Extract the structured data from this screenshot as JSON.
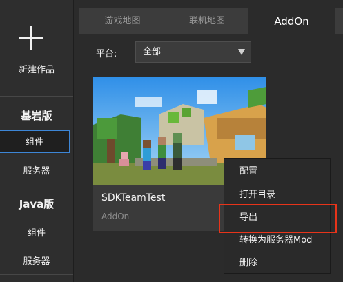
{
  "sidebar": {
    "new_work_label": "新建作品",
    "bedrock": {
      "title": "基岩版",
      "items": [
        "组件",
        "服务器"
      ]
    },
    "java": {
      "title": "Java版",
      "items": [
        "组件",
        "服务器"
      ]
    }
  },
  "tabs": [
    {
      "label": "游戏地图",
      "active": false
    },
    {
      "label": "联机地图",
      "active": false
    },
    {
      "label": "AddOn",
      "active": true
    }
  ],
  "filter": {
    "label": "平台:",
    "selected": "全部"
  },
  "card": {
    "title": "SDKTeamTest",
    "type": "AddOn",
    "thumbnail": "minecraft-scene-image"
  },
  "context_menu": {
    "items": [
      "配置",
      "打开目录",
      "导出",
      "转换为服务器Mod",
      "删除"
    ],
    "highlighted": "导出"
  },
  "colors": {
    "accent": "#3d86d6",
    "highlight": "#e7341a"
  }
}
